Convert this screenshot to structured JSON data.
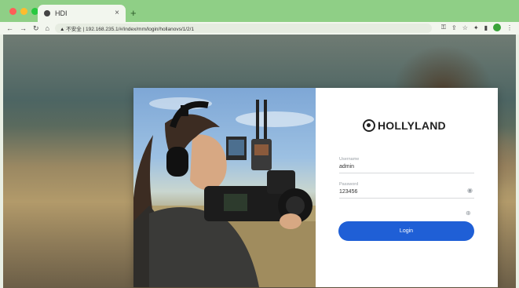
{
  "browser": {
    "tab_title": "HDI",
    "address": "▲ 不安全 | 192.168.235.1/#/index/mm/login/hollanovs/1/2/1",
    "colors": {
      "chrome": "#7cc277",
      "accent": "#1f5fd6"
    }
  },
  "login": {
    "brand": "HOLLYLAND",
    "username_label": "Username",
    "username_value": "admin",
    "password_label": "Password",
    "password_value": "123456",
    "login_label": "Login"
  }
}
